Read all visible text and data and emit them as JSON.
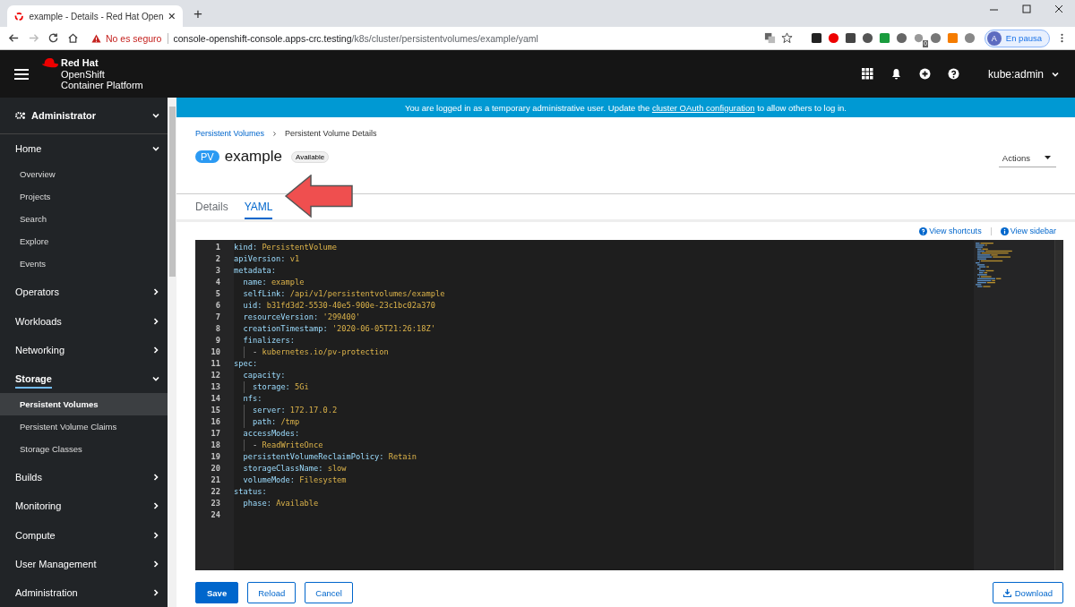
{
  "browser": {
    "tab_title": "example - Details - Red Hat Open",
    "new_tab": "+",
    "security": "No es seguro",
    "url_host": "console-openshift-console.apps-crc.testing",
    "url_path": "/k8s/cluster/persistentvolumes/example/yaml",
    "extension_badge": "0",
    "profile_initial": "A",
    "profile_status": "En pausa"
  },
  "masthead": {
    "brand_line1": "Red Hat",
    "brand_line2": "OpenShift",
    "brand_line3": "Container Platform",
    "user": "kube:admin"
  },
  "sidebar": {
    "perspective": "Administrator",
    "nav": [
      {
        "label": "Home",
        "expanded": true,
        "selected": false,
        "children": [
          {
            "label": "Overview",
            "selected": false
          },
          {
            "label": "Projects",
            "selected": false
          },
          {
            "label": "Search",
            "selected": false
          },
          {
            "label": "Explore",
            "selected": false
          },
          {
            "label": "Events",
            "selected": false
          }
        ]
      },
      {
        "label": "Operators",
        "expanded": false,
        "selected": false
      },
      {
        "label": "Workloads",
        "expanded": false,
        "selected": false
      },
      {
        "label": "Networking",
        "expanded": false,
        "selected": false
      },
      {
        "label": "Storage",
        "expanded": true,
        "selected": true,
        "children": [
          {
            "label": "Persistent Volumes",
            "selected": true
          },
          {
            "label": "Persistent Volume Claims",
            "selected": false
          },
          {
            "label": "Storage Classes",
            "selected": false
          }
        ]
      },
      {
        "label": "Builds",
        "expanded": false,
        "selected": false
      },
      {
        "label": "Monitoring",
        "expanded": false,
        "selected": false
      },
      {
        "label": "Compute",
        "expanded": false,
        "selected": false
      },
      {
        "label": "User Management",
        "expanded": false,
        "selected": false
      },
      {
        "label": "Administration",
        "expanded": false,
        "selected": false
      }
    ]
  },
  "banner": {
    "text_before": "You are logged in as a temporary administrative user. Update the",
    "link": "cluster OAuth configuration",
    "text_after": "to allow others to log in."
  },
  "breadcrumb": [
    "Persistent Volumes",
    "Persistent Volume Details"
  ],
  "title": {
    "badge": "PV",
    "name": "example",
    "status": "Available"
  },
  "actions": "Actions",
  "tabs": [
    {
      "label": "Details",
      "selected": false
    },
    {
      "label": "YAML",
      "selected": true
    }
  ],
  "editor_links": [
    "View shortcuts",
    "View sidebar"
  ],
  "code": [
    {
      "number": "1",
      "kind": "pair",
      "key": "kind:",
      "value": "PersistentVolume"
    },
    {
      "number": "2",
      "kind": "pair",
      "key": "apiVersion:",
      "value": "v1"
    },
    {
      "number": "3",
      "kind": "pair",
      "key": "metadata:",
      "children": [
        {
          "number": "4",
          "kind": "pair",
          "key": "name:",
          "value": "example"
        },
        {
          "number": "5",
          "kind": "pair",
          "key": "selfLink:",
          "value": "/api/v1/persistentvolumes/example"
        },
        {
          "number": "6",
          "kind": "pair",
          "key": "uid:",
          "value": "b31fd3d2-5530-40e5-900e-23c1bc02a370"
        },
        {
          "number": "7",
          "kind": "pair",
          "key": "resourceVersion:",
          "value": "'299400'"
        },
        {
          "number": "8",
          "kind": "pair",
          "key": "creationTimestamp:",
          "value": "'2020-06-05T21:26:18Z'"
        },
        {
          "number": "9",
          "kind": "pair",
          "key": "finalizers:",
          "children": [
            {
              "number": "10",
              "kind": "item",
              "key": "-",
              "value": "kubernetes.io/pv-protection"
            }
          ]
        }
      ]
    },
    {
      "number": "11",
      "kind": "pair",
      "key": "spec:",
      "children": [
        {
          "number": "12",
          "kind": "pair",
          "key": "capacity:",
          "children": [
            {
              "number": "13",
              "kind": "pair",
              "key": "storage:",
              "value": "5Gi"
            }
          ]
        },
        {
          "number": "14",
          "kind": "pair",
          "key": "nfs:",
          "children": [
            {
              "number": "15",
              "kind": "pair",
              "key": "server:",
              "value": "172.17.0.2"
            },
            {
              "number": "16",
              "kind": "pair",
              "key": "path:",
              "value": "/tmp"
            }
          ]
        },
        {
          "number": "17",
          "kind": "pair",
          "key": "accessModes:",
          "children": [
            {
              "number": "18",
              "kind": "item",
              "key": "-",
              "value": "ReadWriteOnce"
            }
          ]
        },
        {
          "number": "19",
          "kind": "pair",
          "key": "persistentVolumeReclaimPolicy:",
          "value": "Retain"
        },
        {
          "number": "20",
          "kind": "pair",
          "key": "storageClassName:",
          "value": "slow"
        },
        {
          "number": "21",
          "kind": "pair",
          "key": "volumeMode:",
          "value": "Filesystem"
        }
      ]
    },
    {
      "number": "22",
      "kind": "pair",
      "key": "status:",
      "children": [
        {
          "number": "23",
          "kind": "pair",
          "key": "phase:",
          "value": "Available"
        }
      ]
    },
    {
      "number": "24",
      "kind": "blank"
    }
  ],
  "buttons": [
    {
      "label": "Save",
      "kind": "primary"
    },
    {
      "label": "Reload",
      "kind": "secondary"
    },
    {
      "label": "Cancel",
      "kind": "secondary"
    }
  ],
  "download": "Download"
}
